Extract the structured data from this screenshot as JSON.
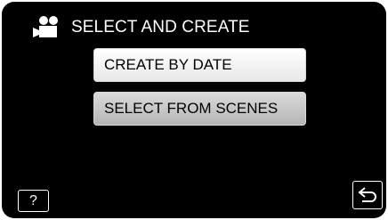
{
  "header": {
    "mode_icon": "video-camera-icon",
    "title": "SELECT AND CREATE"
  },
  "menu": {
    "items": [
      {
        "label": "CREATE BY DATE",
        "state": "normal"
      },
      {
        "label": "SELECT FROM SCENES",
        "state": "selected"
      }
    ]
  },
  "footer": {
    "help_label": "?",
    "back_icon": "return-arrow-icon"
  },
  "colors": {
    "background": "#000000",
    "text": "#ffffff",
    "button_text": "#000000",
    "button_normal": "#f2f2f2",
    "button_selected": "#c4c4c4"
  }
}
